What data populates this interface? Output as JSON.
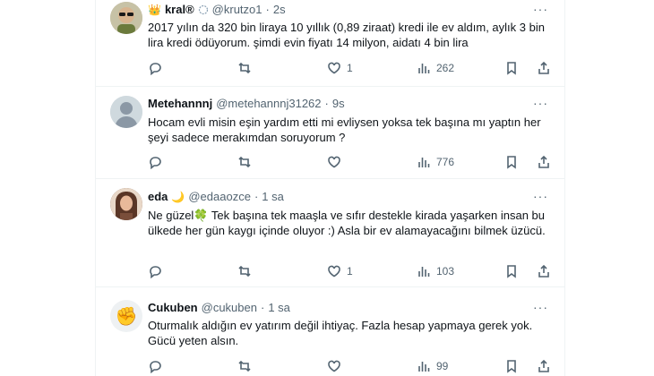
{
  "tweets": [
    {
      "name": "kral®",
      "name_prefix_emoji": "👑",
      "badge_emoji": "",
      "handle": "@krutzo1",
      "dot": "·",
      "time": "2s",
      "text": "2017 yılın da 320 bin liraya 10 yıllık (0,89 ziraat) kredi ile ev aldım, aylık 3 bin lira kredi ödüyorum.  şimdi evin fiyatı 14 milyon, aidatı 4 bin lira",
      "replies": "",
      "retweets": "",
      "likes": "1",
      "views": "262",
      "avatar_icon": "avatar-sunglasses-man"
    },
    {
      "name": "Metehannnj",
      "name_prefix_emoji": "",
      "badge_emoji": "",
      "handle": "@metehannnj31262",
      "dot": "·",
      "time": "9s",
      "text": "Hocam evli misin eşin yardım etti mi evliysen yoksa tek başına mı yaptın her şeyi sadece merakımdan soruyorum ?",
      "replies": "",
      "retweets": "",
      "likes": "",
      "views": "776",
      "avatar_icon": "default-avatar-icon"
    },
    {
      "name": "eda",
      "name_prefix_emoji": "",
      "badge_emoji": "🌙",
      "handle": "@edaaozce",
      "dot": "·",
      "time": "1 sa",
      "text": "Ne güzel🍀 Tek başına tek maaşla ve sıfır destekle  kirada yaşarken insan bu ülkede her gün kaygı içinde oluyor :) Asla bir ev alamayacağını bilmek üzücü.",
      "replies": "",
      "retweets": "",
      "likes": "1",
      "views": "103",
      "avatar_icon": "avatar-woman-photo"
    },
    {
      "name": "Cukuben",
      "name_prefix_emoji": "",
      "badge_emoji": "",
      "handle": "@cukuben",
      "dot": "·",
      "time": "1 sa",
      "text": "Oturmalık aldığın ev yatırım değil ihtiyaç. Fazla hesap yapmaya gerek yok. Gücü yeten alsın.",
      "replies": "",
      "retweets": "",
      "likes": "",
      "views": "99",
      "avatar_icon": "fist-emoji-icon"
    }
  ],
  "more_label": "···",
  "colors": {
    "text": "#0f1419",
    "muted": "#536471",
    "divider": "#eff3f4"
  }
}
